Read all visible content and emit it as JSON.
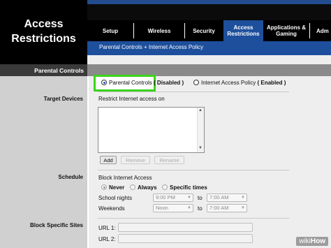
{
  "header": {
    "title_line1": "Access",
    "title_line2": "Restrictions",
    "tabs": [
      {
        "label": "Setup"
      },
      {
        "label": "Wireless"
      },
      {
        "label": "Security"
      },
      {
        "label_line1": "Access",
        "label_line2": "Restrictions",
        "active": true
      },
      {
        "label_line1": "Applications &",
        "label_line2": "Gaming"
      },
      {
        "label": "Adm"
      }
    ],
    "subnav": "Parental Controls  +  Internet Access Policy"
  },
  "sidebar": {
    "section": "Parental Controls",
    "target_devices": "Target Devices",
    "schedule": "Schedule",
    "block_sites": "Block Specific Sites"
  },
  "mode": {
    "parental_label": "Parental Controls",
    "parental_status": "( Disabled )",
    "policy_label": "Internet Access Policy",
    "policy_status": "( Enabled )",
    "selected": "parental"
  },
  "target": {
    "restrict_label": "Restrict Internet access on",
    "add": "Add",
    "remove": "Remove",
    "rename": "Rename"
  },
  "schedule": {
    "block_label": "Block Internet Access",
    "never": "Never",
    "always": "Always",
    "specific": "Specific times",
    "school_nights": "School nights",
    "school_from": "9:00 PM",
    "to1": "to",
    "school_to": "7:00 AM",
    "weekends": "Weekends",
    "weekend_from": "Noon",
    "to2": "to",
    "weekend_to": "7:00 AM"
  },
  "sites": {
    "url1": "URL 1:",
    "url2": "URL 2:"
  },
  "watermark": {
    "wiki": "wiki",
    "how": "How"
  },
  "colors": {
    "header_black": "#000000",
    "active_tab_blue": "#1d4f9c",
    "highlight_green": "#3cd31b"
  }
}
